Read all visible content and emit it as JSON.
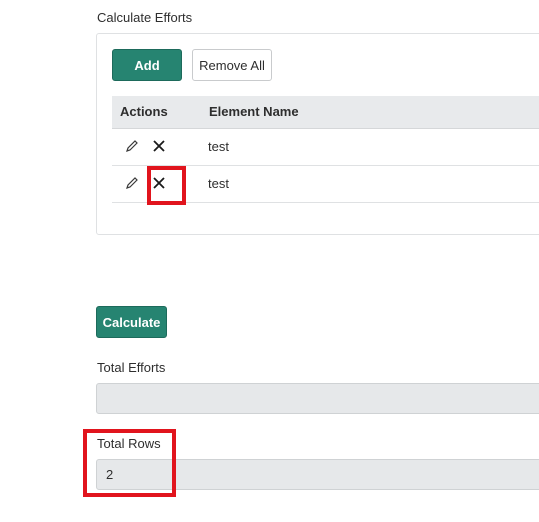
{
  "calculate_efforts": {
    "title": "Calculate Efforts",
    "add_label": "Add",
    "remove_all_label": "Remove All",
    "columns": [
      "Actions",
      "Element Name"
    ],
    "rows": [
      {
        "name": "test"
      },
      {
        "name": "test"
      }
    ]
  },
  "calculate_label": "Calculate",
  "total_efforts": {
    "label": "Total Efforts",
    "value": ""
  },
  "total_rows": {
    "label": "Total Rows",
    "value": "2"
  },
  "highlight_color": "#e1141d",
  "accent_color": "#268471"
}
